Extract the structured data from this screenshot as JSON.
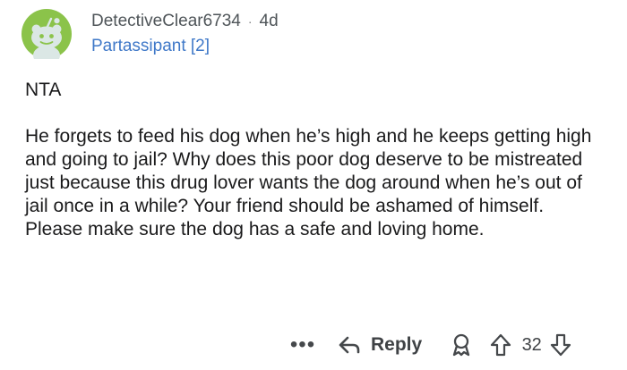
{
  "comment": {
    "username": "DetectiveClear6734",
    "separator": "·",
    "age": "4d",
    "flair": "Partassipant [2]",
    "paragraphs": [
      "NTA",
      "He forgets to feed his dog when he’s high and he keeps getting high and going to jail? Why does this poor dog deserve to be mistreated just because this drug lover wants the dog around when he’s out of jail once in a while? Your friend should be ashamed of himself. Please make sure the dog has a safe and loving home."
    ]
  },
  "actions": {
    "more_label": "•••",
    "reply_label": "Reply",
    "score": "32",
    "icons": {
      "more": "ellipsis-icon",
      "reply": "reply-arrow-icon",
      "award": "award-icon",
      "upvote": "upvote-arrow-icon",
      "downvote": "downvote-arrow-icon"
    }
  },
  "avatar": {
    "icon": "reddit-snoo-avatar-icon",
    "color": "#8bc34a"
  }
}
